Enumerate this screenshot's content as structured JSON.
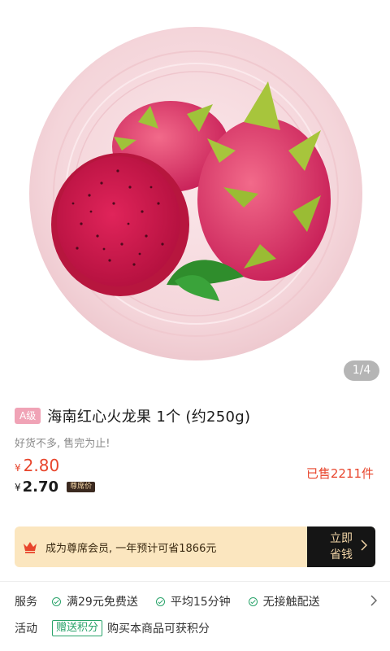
{
  "product": {
    "image_pager": "1/4",
    "grade_badge": "A级",
    "title": "海南红心火龙果  1个 (约250g)",
    "subtitle": "好货不多, 售完为止!",
    "price": {
      "currency": "¥",
      "value": "2.80"
    },
    "member_price": {
      "currency": "¥",
      "value": "2.70",
      "tag": "尊席价"
    },
    "sold": "已售2211件"
  },
  "vip_banner": {
    "icon": "crown-icon",
    "text": "成为尊席会员, 一年预计可省1866元",
    "button_label": "立即省钱"
  },
  "services": {
    "label": "服务",
    "items": [
      "满29元免费送",
      "平均15分钟",
      "无接触配送"
    ]
  },
  "activity": {
    "label": "活动",
    "tag": "赠送积分",
    "text": "购买本商品可获积分"
  },
  "colors": {
    "price_red": "#e8452c",
    "banner_bg": "#fbe6bf",
    "banner_btn": "#151515",
    "service_green": "#29a36a",
    "plate_pink": "#f6dbe0"
  }
}
